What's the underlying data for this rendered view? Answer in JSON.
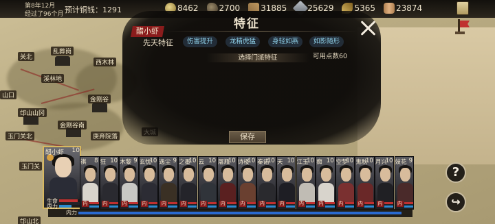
{
  "status": {
    "date_line1": "第8年12月",
    "date_line2": "经过了96个月",
    "money": "预计铜钱：1291"
  },
  "resources": [
    {
      "name": "coin-icon",
      "value": "8462"
    },
    {
      "name": "food-icon",
      "value": "2700"
    },
    {
      "name": "wood-icon",
      "value": "31885"
    },
    {
      "name": "iron-icon",
      "value": "25629"
    },
    {
      "name": "herb-icon",
      "value": "5365"
    },
    {
      "name": "log-icon",
      "value": "23874"
    }
  ],
  "panel": {
    "title": "特征",
    "character": "醋小虾",
    "innate_label": "先天特征",
    "innate_traits": [
      "伤害提升",
      "龙精虎猛",
      "身轻如燕",
      "如影随形"
    ],
    "points": "可用点数60",
    "sect_select": "选择门派特征",
    "save": "保存",
    "close": "✕"
  },
  "map_places": [
    "乱葬岗",
    "关北",
    "西木林",
    "溪林地",
    "山口",
    "金刚谷",
    "邙山山冈",
    "金刚谷南",
    "玉门关北",
    "庚弃院落",
    "玉门关",
    "邙山北",
    "大城"
  ],
  "selected_hero": {
    "name": "醋小虾",
    "level": "10",
    "hp_label": "生命",
    "mp_label": "内力",
    "hp": 0.9,
    "mp": 0.6
  },
  "heroes": [
    {
      "name": "祺",
      "level": "8",
      "badge": "内",
      "robe": "#d8d4cc"
    },
    {
      "name": "狂",
      "level": "10",
      "badge": "内",
      "robe": "#2a2a30"
    },
    {
      "name": "木黎",
      "level": "9",
      "badge": "内",
      "robe": "#c8c8c4"
    },
    {
      "name": "玄忧",
      "level": "10",
      "badge": "内",
      "robe": "#2c2c34"
    },
    {
      "name": "逸尘",
      "level": "9",
      "badge": "内",
      "robe": "#3a3024"
    },
    {
      "name": "之墨",
      "level": "10",
      "badge": "内",
      "robe": "#24242a"
    },
    {
      "name": "云",
      "level": "10",
      "badge": "内",
      "robe": "#30343a"
    },
    {
      "name": "屠瓶",
      "level": "10",
      "badge": "内",
      "robe": "#5a2020"
    },
    {
      "name": "诗楼",
      "level": "10",
      "badge": "内",
      "robe": "#6a4030"
    },
    {
      "name": "秦诺",
      "level": "10",
      "badge": "内",
      "robe": "#2a2a2e"
    },
    {
      "name": "天",
      "level": "10",
      "badge": "内",
      "robe": "#1e1e24"
    },
    {
      "name": "江玉",
      "level": "10",
      "badge": "内",
      "robe": "#c0bcb4"
    },
    {
      "name": "痴",
      "level": "10",
      "badge": "内",
      "robe": "#d8d4cc"
    },
    {
      "name": "空梦",
      "level": "10",
      "badge": "内",
      "robe": "#7a3030"
    },
    {
      "name": "鬼秋",
      "level": "10",
      "badge": "内",
      "robe": "#6a2828"
    },
    {
      "name": "月兴",
      "level": "10",
      "badge": "内",
      "robe": "#202024"
    },
    {
      "name": "妓花",
      "level": "9",
      "badge": "内",
      "robe": "#4a2a2a"
    }
  ],
  "team_bar_label": "内力",
  "buttons": {
    "help": "?",
    "share": "↪"
  },
  "colors": {
    "accent_red": "#8a1c1c",
    "trait_blue": "#8fd0e8",
    "gold": "#d8b860"
  }
}
